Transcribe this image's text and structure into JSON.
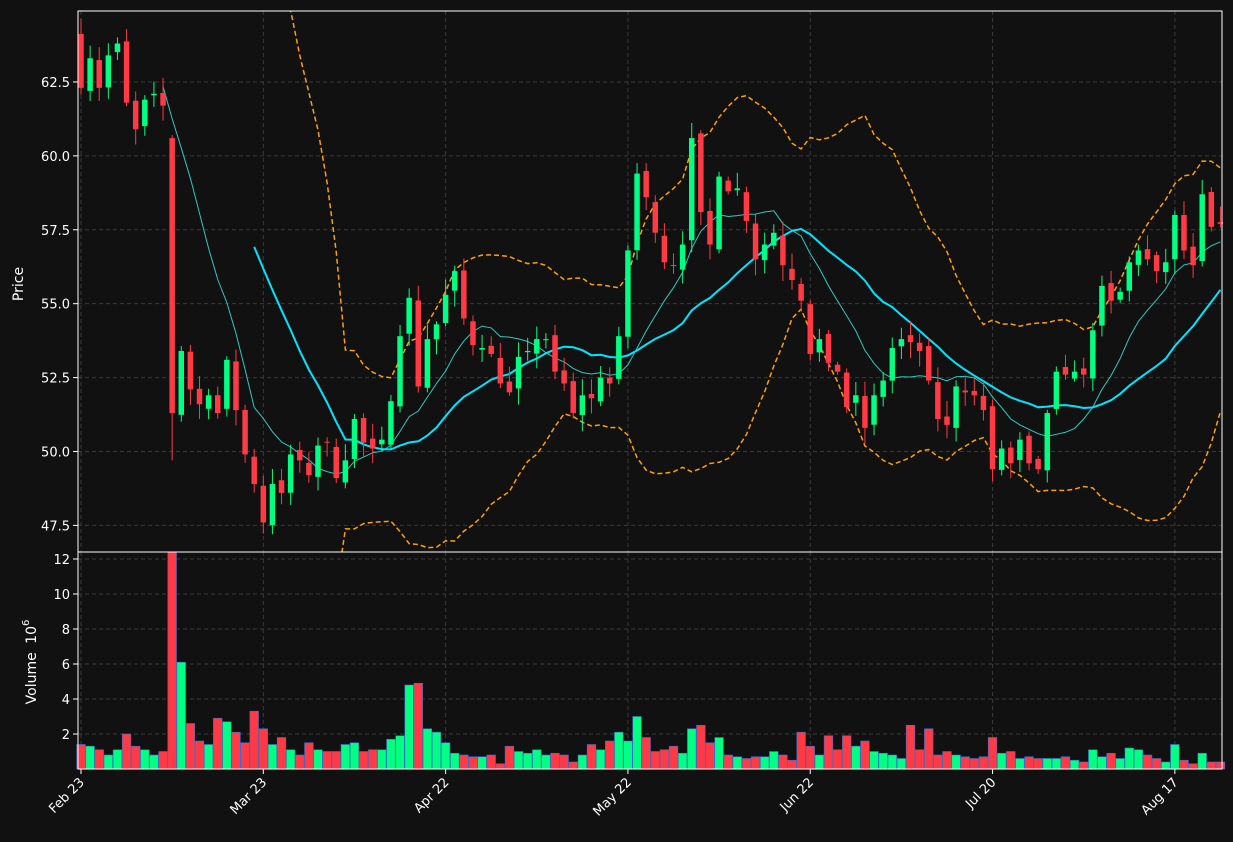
{
  "chart_data": {
    "type": "candlestick",
    "colors": {
      "background": "#111111",
      "up": "#00ff83",
      "down": "#ff3a44",
      "ma_fast": "#2ec9c2",
      "ma_slow": "#00e5ff",
      "bands": "#ffa000",
      "grid": "#3a3a3a",
      "axis": "#ffffff"
    },
    "price_panel": {
      "ylabel": "Price",
      "ylim": [
        46.6,
        64.9
      ],
      "yticks": [
        "47.5",
        "50.0",
        "52.5",
        "55.0",
        "57.5",
        "60.0",
        "62.5"
      ],
      "grid": true
    },
    "volume_panel": {
      "ylabel": "Volume",
      "ylabel_exponent": "10",
      "ylabel_exponent_power": "6",
      "ylim": [
        0,
        12.4
      ],
      "yticks": [
        "2",
        "4",
        "6",
        "8",
        "10",
        "12"
      ],
      "grid": true
    },
    "x_ticks": [
      {
        "label": "Feb 23",
        "index": 0
      },
      {
        "label": "Mar 23",
        "index": 20
      },
      {
        "label": "Apr 22",
        "index": 40
      },
      {
        "label": "May 22",
        "index": 60
      },
      {
        "label": "Jun 22",
        "index": 80
      },
      {
        "label": "Jul 20",
        "index": 100
      },
      {
        "label": "Aug 17",
        "index": 120
      }
    ],
    "closes": [
      62.3,
      63.3,
      62.3,
      63.4,
      63.8,
      61.8,
      60.9,
      61.9,
      62.1,
      61.7,
      51.3,
      53.4,
      52.1,
      51.6,
      51.9,
      51.3,
      53.1,
      51.4,
      49.9,
      48.9,
      47.6,
      48.9,
      48.6,
      49.9,
      49.7,
      49.2,
      50.2,
      50.3,
      49.1,
      49.7,
      51.1,
      50.3,
      50.1,
      50.4,
      51.7,
      53.9,
      55.2,
      52.2,
      53.8,
      54.3,
      55.3,
      56.1,
      54.5,
      53.6,
      53.5,
      53.3,
      52.3,
      52.0,
      53.2,
      53.4,
      53.8,
      53.8,
      52.7,
      52.3,
      51.3,
      51.9,
      51.8,
      52.5,
      52.3,
      53.9,
      56.8,
      59.4,
      58.6,
      57.4,
      56.4,
      56.3,
      57.0,
      60.6,
      58.1,
      57.0,
      59.3,
      58.8,
      58.9,
      57.8,
      56.5,
      57.0,
      57.4,
      56.3,
      55.8,
      55.1,
      53.3,
      53.8,
      53.0,
      52.7,
      51.5,
      51.9,
      50.8,
      51.9,
      52.4,
      53.5,
      53.8,
      53.7,
      53.4,
      52.4,
      51.1,
      50.9,
      52.2,
      52.0,
      51.9,
      51.4,
      49.4,
      50.1,
      49.6,
      50.4,
      49.6,
      49.4,
      51.3,
      52.7,
      52.6,
      52.7,
      52.6,
      54.1,
      55.6,
      55.1,
      55.4,
      56.4,
      56.8,
      56.5,
      56.1,
      56.4,
      58.0,
      56.8,
      56.3,
      58.7,
      57.6,
      57.7
    ],
    "volumes": [
      1.4,
      1.3,
      1.1,
      0.8,
      1.1,
      2.0,
      1.3,
      1.1,
      0.8,
      1.0,
      12.4,
      6.1,
      2.6,
      1.6,
      1.4,
      2.9,
      2.7,
      2.1,
      1.5,
      3.3,
      2.3,
      1.4,
      1.8,
      1.1,
      0.8,
      1.5,
      1.1,
      1.0,
      1.0,
      1.4,
      1.5,
      1.0,
      1.1,
      1.1,
      1.7,
      1.9,
      4.8,
      4.9,
      2.3,
      2.1,
      1.5,
      0.9,
      0.8,
      0.7,
      0.7,
      0.8,
      0.3,
      1.3,
      1.0,
      0.9,
      1.1,
      0.8,
      0.9,
      0.8,
      0.4,
      0.8,
      1.4,
      1.1,
      1.6,
      2.1,
      1.6,
      3.0,
      1.8,
      1.0,
      1.1,
      1.3,
      0.9,
      2.3,
      2.5,
      1.5,
      1.8,
      0.8,
      0.7,
      0.6,
      0.7,
      0.7,
      1.0,
      0.8,
      0.5,
      2.1,
      1.3,
      0.8,
      1.9,
      1.1,
      1.9,
      1.3,
      1.6,
      1.0,
      0.9,
      0.8,
      0.6,
      2.5,
      1.1,
      2.3,
      0.8,
      1.0,
      0.8,
      0.7,
      0.6,
      0.7,
      1.8,
      0.9,
      1.0,
      0.6,
      0.7,
      0.6,
      0.6,
      0.6,
      0.7,
      0.5,
      0.4,
      1.1,
      0.7,
      0.9,
      0.6,
      1.2,
      1.1,
      0.8,
      0.6,
      0.4,
      1.4,
      0.5,
      0.3,
      0.9,
      0.4,
      0.4
    ]
  }
}
